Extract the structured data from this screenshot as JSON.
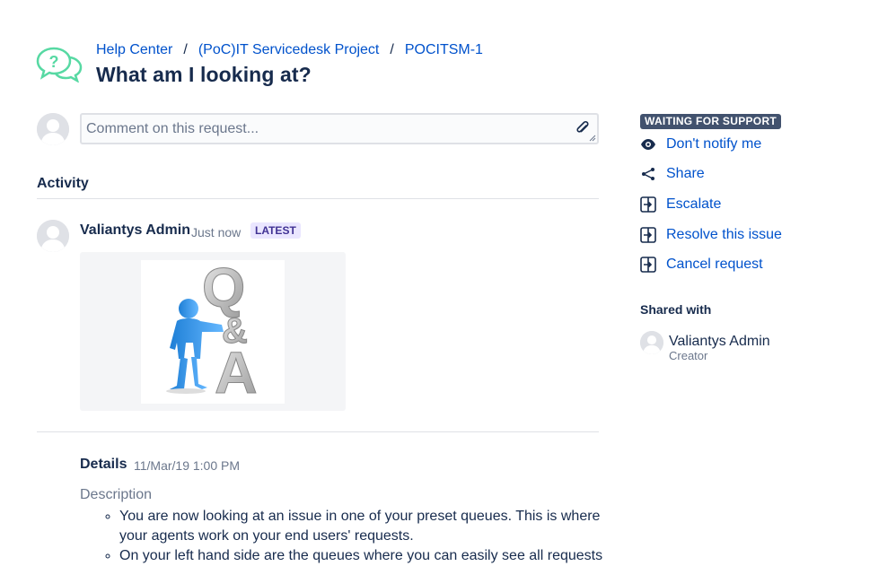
{
  "breadcrumb": {
    "items": [
      "Help Center",
      "(PoC)IT Servicedesk Project",
      "POCITSM-1"
    ],
    "separator": "/"
  },
  "request": {
    "title": "What am I looking at?"
  },
  "comment": {
    "placeholder": "Comment on this request..."
  },
  "activity": {
    "heading": "Activity",
    "entries": [
      {
        "author": "Valiantys Admin",
        "time": "Just now",
        "badge": "LATEST",
        "attachment_icon": "q-and-a-figure-image"
      }
    ]
  },
  "details": {
    "label": "Details",
    "date": "11/Mar/19 1:00 PM",
    "description_label": "Description",
    "description_items": [
      "You are now looking at an issue in one of your preset queues. This is where your agents work on your end users' requests.",
      "On your left hand side are the queues where you can easily see all requests"
    ]
  },
  "sidebar": {
    "status": "WAITING FOR SUPPORT",
    "actions": [
      {
        "label": "Don't notify me",
        "icon": "eye-icon"
      },
      {
        "label": "Share",
        "icon": "share-icon"
      },
      {
        "label": "Escalate",
        "icon": "transition-icon"
      },
      {
        "label": "Resolve this issue",
        "icon": "transition-icon"
      },
      {
        "label": "Cancel request",
        "icon": "transition-icon"
      }
    ],
    "shared_with": {
      "heading": "Shared with",
      "people": [
        {
          "name": "Valiantys Admin",
          "role": "Creator"
        }
      ]
    }
  },
  "colors": {
    "link": "#0052cc",
    "text": "#172b4d",
    "status_bg": "#42526e",
    "latest_bg": "#eae6ff",
    "latest_text": "#403294",
    "help_icon": "#57d9a3"
  }
}
